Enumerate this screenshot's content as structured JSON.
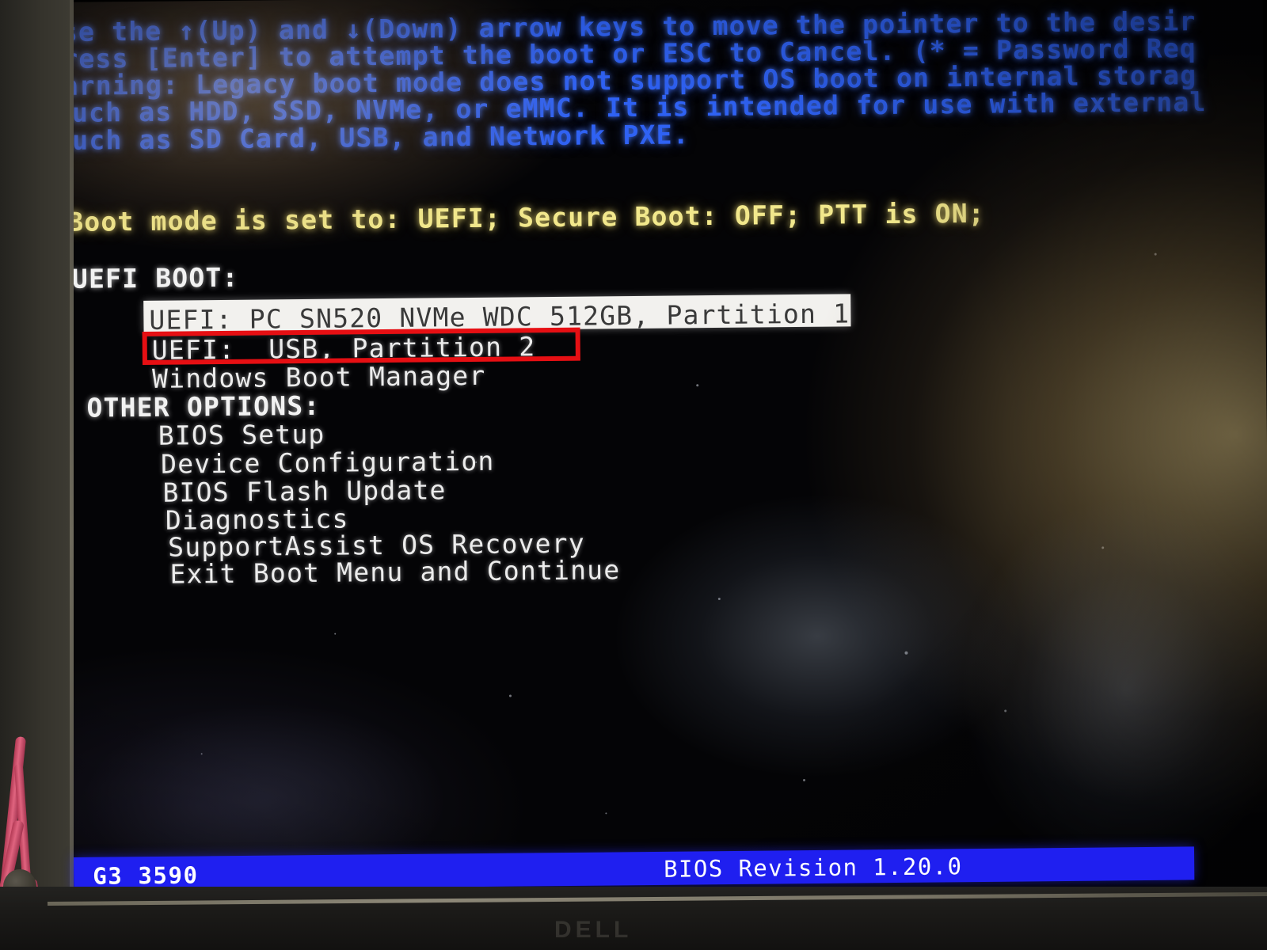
{
  "screen": {
    "instructions": [
      "Use the ↑(Up) and ↓(Down) arrow keys to move the pointer to the desir",
      "Press [Enter] to attempt the boot or ESC to Cancel. (* = Password Req",
      "Warning: Legacy boot mode does not support OS boot on internal storag",
      "such as HDD, SSD, NVMe, or eMMC. It is intended for use with external",
      "such as SD Card, USB, and Network PXE."
    ],
    "boot_mode_line": "Boot mode is set to: UEFI; Secure Boot: OFF; PTT is ON;",
    "uefi_boot": {
      "header": "UEFI BOOT:",
      "items": [
        {
          "label": "UEFI: PC SN520 NVMe WDC 512GB, Partition 1",
          "selected": true,
          "annotated": false
        },
        {
          "label": "UEFI:  USB, Partition 2",
          "selected": false,
          "annotated": true
        },
        {
          "label": "Windows Boot Manager",
          "selected": false,
          "annotated": false
        }
      ]
    },
    "other_options": {
      "header": "OTHER OPTIONS:",
      "items": [
        {
          "label": "BIOS Setup"
        },
        {
          "label": "Device Configuration"
        },
        {
          "label": "BIOS Flash Update"
        },
        {
          "label": "Diagnostics"
        },
        {
          "label": "SupportAssist OS Recovery"
        },
        {
          "label": "Exit Boot Menu and Continue"
        }
      ]
    },
    "status_bar": {
      "model": "G3 3590",
      "bios_revision": "BIOS Revision 1.20.0"
    }
  },
  "hardware": {
    "brand_mark": "DELL"
  },
  "colors": {
    "instruction_blue": "#2f62f4",
    "boot_mode_yellow": "#f2e88c",
    "menu_white": "#ececec",
    "selection_bg": "#f2f1ee",
    "selection_fg": "#3a3a3a",
    "annotation_red": "#e60f13",
    "status_bar_blue": "#1f1ff0",
    "screen_black": "#040406"
  }
}
